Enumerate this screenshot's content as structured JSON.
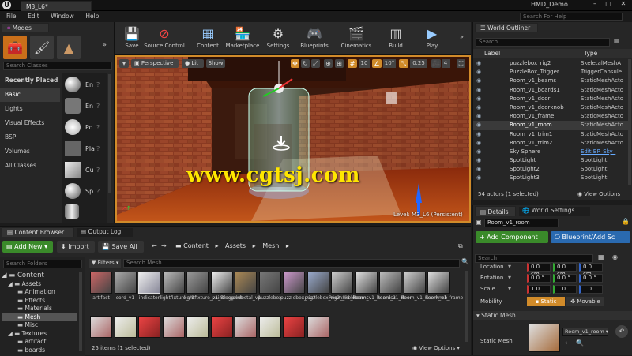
{
  "window": {
    "title": "M3_L6*",
    "project": "HMD_Demo",
    "search_help_placeholder": "Search For Help"
  },
  "menu": [
    "File",
    "Edit",
    "Window",
    "Help"
  ],
  "modes": {
    "title": "Modes",
    "search_placeholder": "Search Classes",
    "categories": [
      "Recently Placed",
      "Basic",
      "Lights",
      "Visual Effects",
      "BSP",
      "Volumes",
      "All Classes"
    ],
    "selected_category": "Basic",
    "assets": [
      "En",
      "En",
      "Po",
      "Pla",
      "Cu",
      "Sp"
    ]
  },
  "toolbar": [
    "Save",
    "Source Control",
    "Content",
    "Marketplace",
    "Settings",
    "Blueprints",
    "Cinematics",
    "Build",
    "Play"
  ],
  "viewport": {
    "perspective": "Perspective",
    "lit": "Lit",
    "show": "Show",
    "grid_snap": "10",
    "rot_snap": "10°",
    "scale_snap": "0.25",
    "cam_speed": "4",
    "level_label": "Level:  M3_L6 (Persistent)"
  },
  "watermark": "www.cgtsj.com",
  "outliner": {
    "title": "World Outliner",
    "search_placeholder": "Search...",
    "col_label": "Label",
    "col_type": "Type",
    "rows": [
      {
        "name": "puzzlebox_rig2",
        "type": "SkeletalMeshA"
      },
      {
        "name": "PuzzleBox_Trigger",
        "type": "TriggerCapsule"
      },
      {
        "name": "Room_v1_beams",
        "type": "StaticMeshActo"
      },
      {
        "name": "Room_v1_boards1",
        "type": "StaticMeshActo"
      },
      {
        "name": "Room_v1_door",
        "type": "StaticMeshActo"
      },
      {
        "name": "Room_v1_doorknob",
        "type": "StaticMeshActo"
      },
      {
        "name": "Room_v1_frame",
        "type": "StaticMeshActo"
      },
      {
        "name": "Room_v1_room",
        "type": "StaticMeshActo"
      },
      {
        "name": "Room_v1_trim1",
        "type": "StaticMeshActo"
      },
      {
        "name": "Room_v1_trim2",
        "type": "StaticMeshActo"
      },
      {
        "name": "Sky Sphere",
        "type": "Edit BP_Sky_"
      },
      {
        "name": "SpotLight",
        "type": "SpotLight"
      },
      {
        "name": "SpotLight2",
        "type": "SpotLight"
      },
      {
        "name": "SpotLight3",
        "type": "SpotLight"
      }
    ],
    "selected_index": 7,
    "status": "54 actors (1 selected)",
    "view_options": "View Options"
  },
  "details": {
    "tab_details": "Details",
    "tab_world": "World Settings",
    "object_name": "Room_v1_room",
    "add_component": "+ Add Component",
    "blueprint_btn": "Blueprint/Add Sc",
    "search_placeholder": "Search",
    "location_label": "Location",
    "location": [
      "0.0 cm",
      "0.0 cm",
      "0.0 cm"
    ],
    "rotation_label": "Rotation",
    "rotation": [
      "0.0 °",
      "0.0 °",
      "0.0 °"
    ],
    "scale_label": "Scale",
    "scale": [
      "1.0",
      "1.0",
      "1.0"
    ],
    "mobility_label": "Mobility",
    "mobility_static": "Static",
    "mobility_movable": "Movable",
    "static_mesh_section": "Static Mesh",
    "static_mesh_label": "Static Mesh",
    "static_mesh_value": "Room_v1_room"
  },
  "content_browser": {
    "tab_cb": "Content Browser",
    "tab_output": "Output Log",
    "add_new": "Add New",
    "import": "Import",
    "save_all": "Save All",
    "path": [
      "Content",
      "Assets",
      "Mesh"
    ],
    "search_folders_placeholder": "Search Folders",
    "filters": "Filters",
    "search_mesh_placeholder": "Search Mesh",
    "tree": [
      {
        "label": "Content",
        "level": 0
      },
      {
        "label": "Assets",
        "level": 1
      },
      {
        "label": "Animation",
        "level": 2
      },
      {
        "label": "Effects",
        "level": 2
      },
      {
        "label": "Materials",
        "level": 2
      },
      {
        "label": "Mesh",
        "level": 2,
        "selected": true
      },
      {
        "label": "Misc",
        "level": 2
      },
      {
        "label": "Textures",
        "level": 1
      },
      {
        "label": "artifact",
        "level": 2
      },
      {
        "label": "boards",
        "level": 2
      }
    ],
    "items": [
      "artifact",
      "cord_v1",
      "indicator",
      "lightfixture_v1",
      "lightfixture_v1_Blueprint",
      "painting",
      "pedestal_v1",
      "puzzlebox",
      "puzzlebox_rig2",
      "puzzlebox_rig2_Skeleton",
      "Room_v1_beams",
      "Room_v1_boards1",
      "Room_v1_door",
      "Room_v1_doorknob",
      "Room_v1_frame"
    ],
    "status": "25 items (1 selected)",
    "view_options": "View Options"
  }
}
